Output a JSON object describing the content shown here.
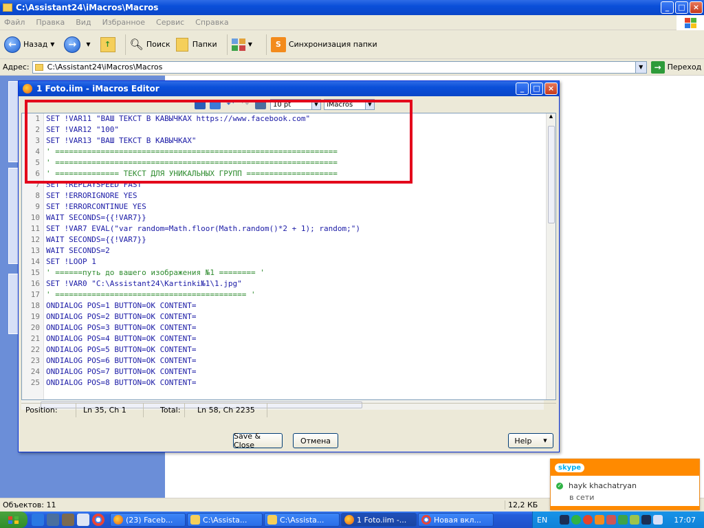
{
  "explorer": {
    "title": "C:\\Assistant24\\iMacros\\Macros",
    "menu": [
      "Файл",
      "Правка",
      "Вид",
      "Избранное",
      "Сервис",
      "Справка"
    ],
    "toolbar": {
      "back": "Назад",
      "search": "Поиск",
      "folders": "Папки",
      "sync": "Синхронизация папки"
    },
    "address": {
      "label": "Адрес:",
      "value": "C:\\Assistant24\\iMacros\\Macros",
      "go": "Переход"
    },
    "status": {
      "objects": "Объектов: 11",
      "size": "12,2 КБ"
    }
  },
  "editor": {
    "title": "1 Foto.iim - iMacros Editor",
    "font_size": "10 pt",
    "mode": "iMacros",
    "line_numbers": [
      "1",
      "2",
      "3",
      "4",
      "5",
      "6",
      "7",
      "8",
      "9",
      "10",
      "11",
      "12",
      "13",
      "14",
      "15",
      "16",
      "17",
      "18",
      "19",
      "20",
      "21",
      "22",
      "23",
      "24",
      "25"
    ],
    "code_lines": [
      "SET !VAR11 \"ВАШ ТЕКСТ В КАВЫЧКАХ https://www.facebook.com\"",
      "SET !VAR12 \"100\"",
      "SET !VAR13 \"ВАШ ТЕКСТ В КАВЫЧКАХ\"",
      "' ==============================================================",
      "' ==============================================================",
      "' ============== ТЕКСТ ДЛЯ УНИКАЛЬНЫХ ГРУПП ====================",
      "SET !REPLAYSPEED FAST",
      "SET !ERRORIGNORE YES",
      "SET !ERRORCONTINUE YES",
      "WAIT SECONDS={{!VAR7}}",
      "SET !VAR7 EVAL(\"var random=Math.floor(Math.random()*2 + 1); random;\")",
      "WAIT SECONDS={{!VAR7}}",
      "WAIT SECONDS=2",
      "SET !LOOP 1",
      "' ======путь до вашего изображения №1 ======== '",
      "SET !VAR0 \"C:\\Assistant24\\Kartinki№1\\1.jpg\"",
      "' ========================================== '",
      "ONDIALOG POS=1 BUTTON=OK CONTENT=",
      "ONDIALOG POS=2 BUTTON=OK CONTENT=",
      "ONDIALOG POS=3 BUTTON=OK CONTENT=",
      "ONDIALOG POS=4 BUTTON=OK CONTENT=",
      "ONDIALOG POS=5 BUTTON=OK CONTENT=",
      "ONDIALOG POS=6 BUTTON=OK CONTENT=",
      "ONDIALOG POS=7 BUTTON=OK CONTENT=",
      "ONDIALOG POS=8 BUTTON=OK CONTENT="
    ],
    "status": {
      "position_label": "Position:",
      "position_value": "Ln 35, Ch 1",
      "total_label": "Total:",
      "total_value": "Ln 58, Ch 2235"
    },
    "buttons": {
      "save_close": "Save & Close",
      "cancel": "Отмена",
      "help": "Help"
    }
  },
  "skype": {
    "logo": "skype",
    "contact": "hayk khachatryan",
    "status": "в сети"
  },
  "taskbar": {
    "tasks": [
      "(23) Faceb...",
      "C:\\Assista...",
      "C:\\Assista...",
      "1 Foto.iim -...",
      "Новая вкл..."
    ],
    "lang": "EN",
    "time": "17:07"
  },
  "colors": {
    "xp_blue": "#0a4fd9",
    "highlight_red": "#e3001b",
    "skype_orange": "#ff8a00"
  }
}
